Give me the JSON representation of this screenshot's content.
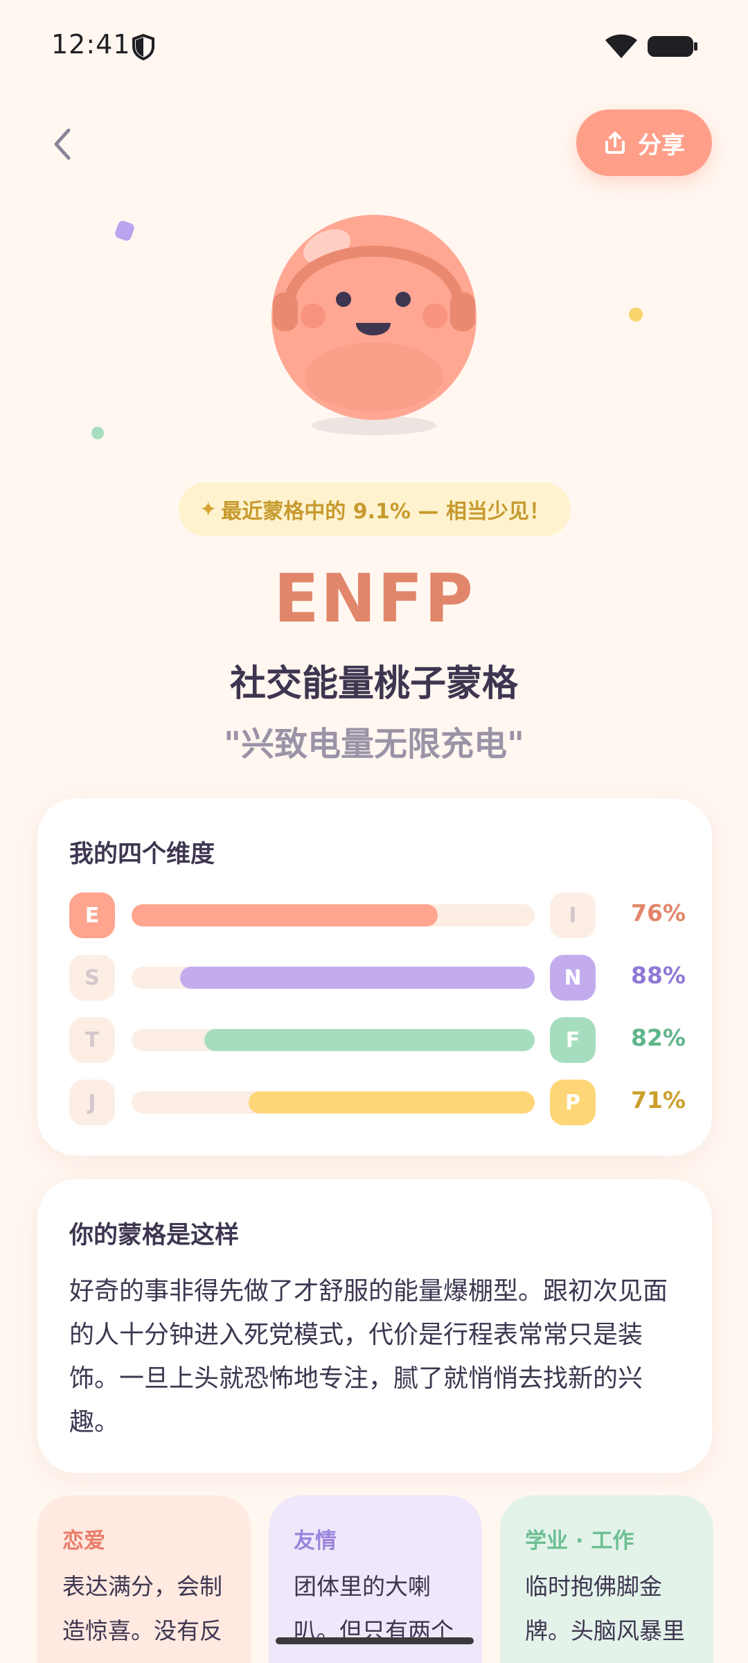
{
  "status_bar": {
    "time": "12:41"
  },
  "header": {
    "share_label": "分享"
  },
  "result": {
    "rarity_text": "最近蒙格中的 9.1% — 相当少见！",
    "type_code": "ENFP",
    "type_name": "社交能量桃子蒙格",
    "slogan": "\"兴致电量无限充电\""
  },
  "dimensions": {
    "title": "我的四个维度",
    "rows": [
      {
        "left": "E",
        "right": "I",
        "winner": "left",
        "percent": 76,
        "percent_label": "76%",
        "color": "#FFA58F",
        "text_color": "#E1866A"
      },
      {
        "left": "S",
        "right": "N",
        "winner": "right",
        "percent": 88,
        "percent_label": "88%",
        "color": "#C2ACEE",
        "text_color": "#8F78D6"
      },
      {
        "left": "T",
        "right": "F",
        "winner": "right",
        "percent": 82,
        "percent_label": "82%",
        "color": "#A6DDBF",
        "text_color": "#5FB58A"
      },
      {
        "left": "J",
        "right": "P",
        "winner": "right",
        "percent": 71,
        "percent_label": "71%",
        "color": "#FFD677",
        "text_color": "#CC9F2E"
      }
    ]
  },
  "description": {
    "title": "你的蒙格是这样",
    "text": "好奇的事非得先做了才舒服的能量爆棚型。跟初次见面的人十分钟进入死党模式，代价是行程表常常只是装饰。一旦上头就恐怖地专注，腻了就悄悄去找新的兴趣。"
  },
  "categories": [
    {
      "title": "恋爱",
      "text": "表达满分，会制造惊喜。没有反应就会失落",
      "color": "#E97E6A"
    },
    {
      "title": "友情",
      "text": "团体里的大喇叭。但只有两个人时才说真心话",
      "color": "#9C84DE"
    },
    {
      "title": "学业 · 工作",
      "text": "临时抱佛脚金牌。头脑风暴里的王牌",
      "color": "#6CBF92"
    }
  ]
}
